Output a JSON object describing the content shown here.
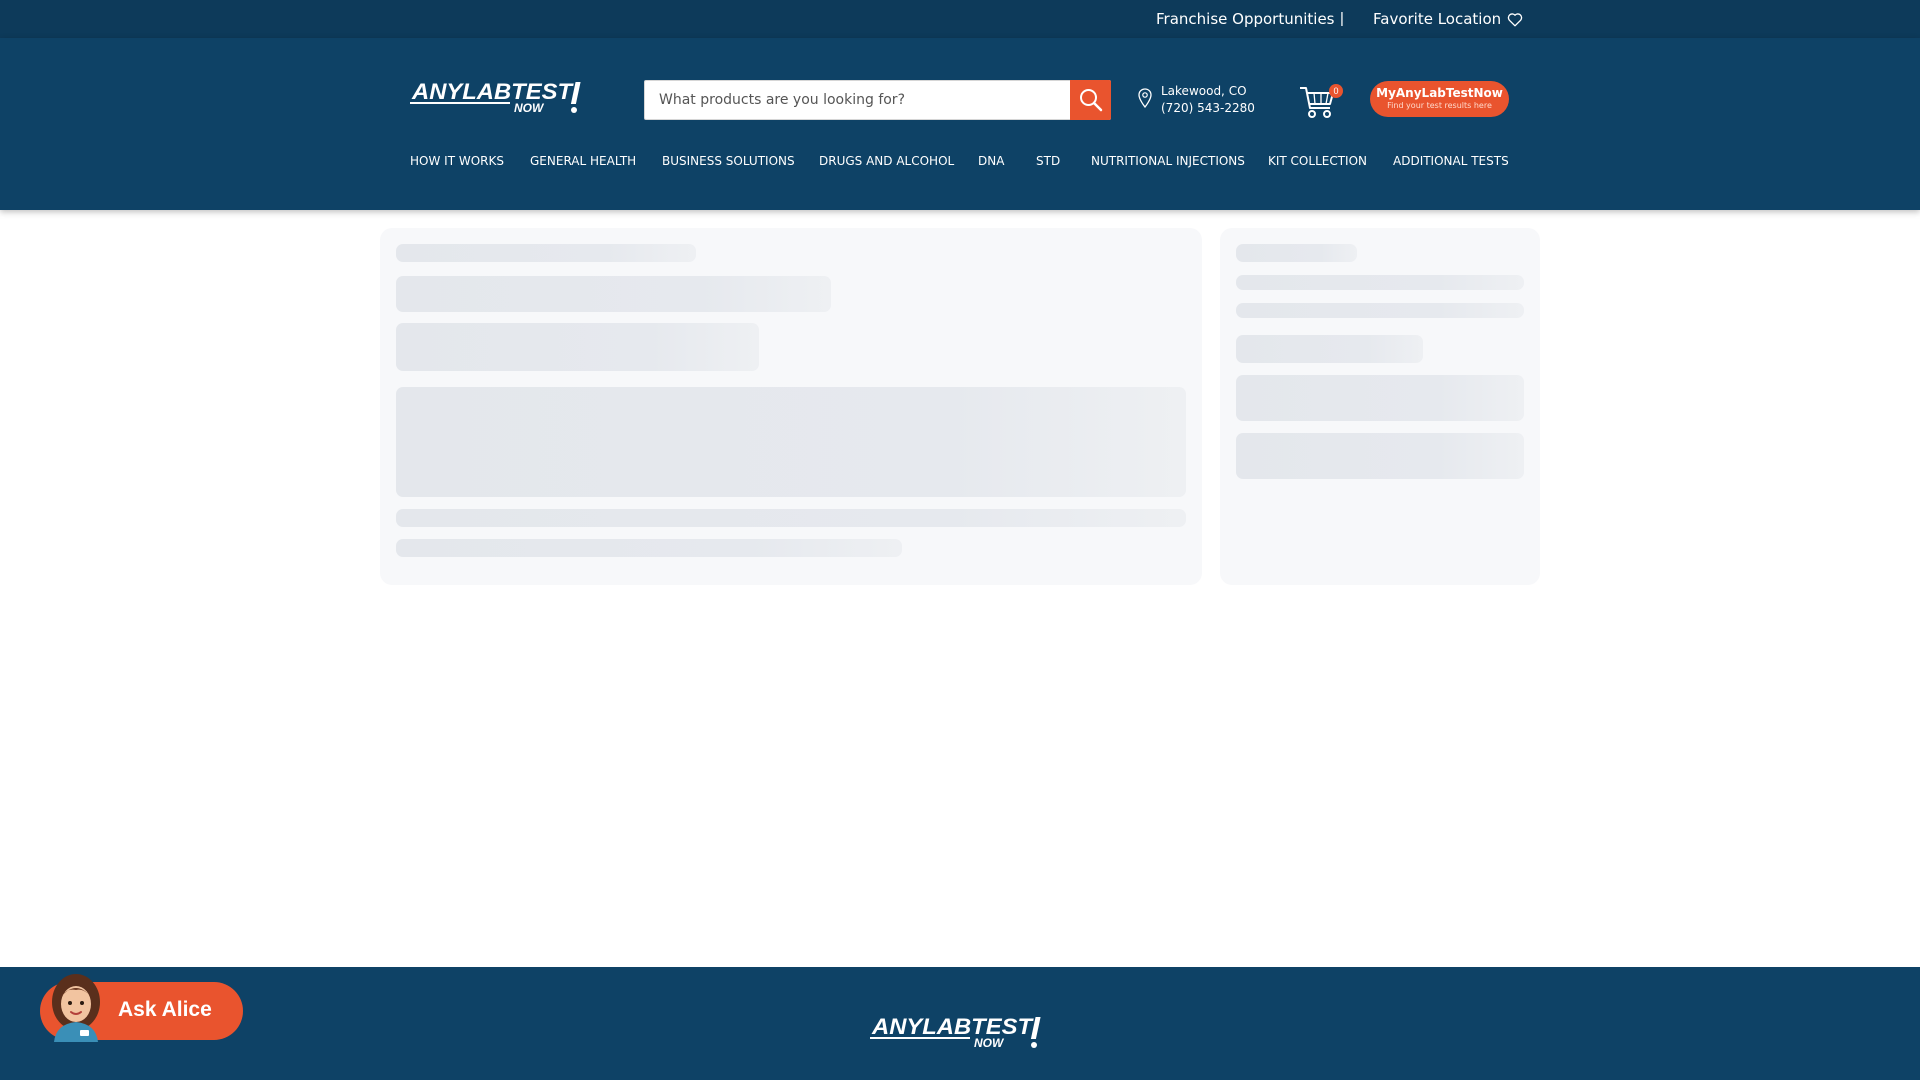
{
  "topbar": {
    "franchise_label": "Franchise Opportunities",
    "divider": "|",
    "favorite_label": "Favorite Location"
  },
  "header": {
    "logo_text": "ANYLABTEST NOW",
    "search_placeholder": "What products are you looking for?",
    "location": {
      "city": "Lakewood, CO",
      "phone": "(720) 543-2280"
    },
    "cart_count": "0",
    "account": {
      "title": "MyAnyLabTestNow",
      "subtitle": "Find your test results here"
    }
  },
  "nav": [
    "HOW IT WORKS",
    "GENERAL HEALTH",
    "BUSINESS SOLUTIONS",
    "DRUGS AND ALCOHOL",
    "DNA",
    "STD",
    "NUTRITIONAL INJECTIONS",
    "KIT COLLECTION",
    "ADDITIONAL TESTS"
  ],
  "chat": {
    "label": "Ask Alice"
  },
  "footer": {
    "logo_text": "ANYLABTEST NOW"
  },
  "colors": {
    "navy": "#0e4266",
    "topbar": "#0d3a5a",
    "accent": "#e9542e",
    "skeleton": "#e4e7ec"
  },
  "icons": [
    "heart-icon",
    "search-icon",
    "location-pin-icon",
    "cart-icon",
    "alice-avatar-icon"
  ]
}
